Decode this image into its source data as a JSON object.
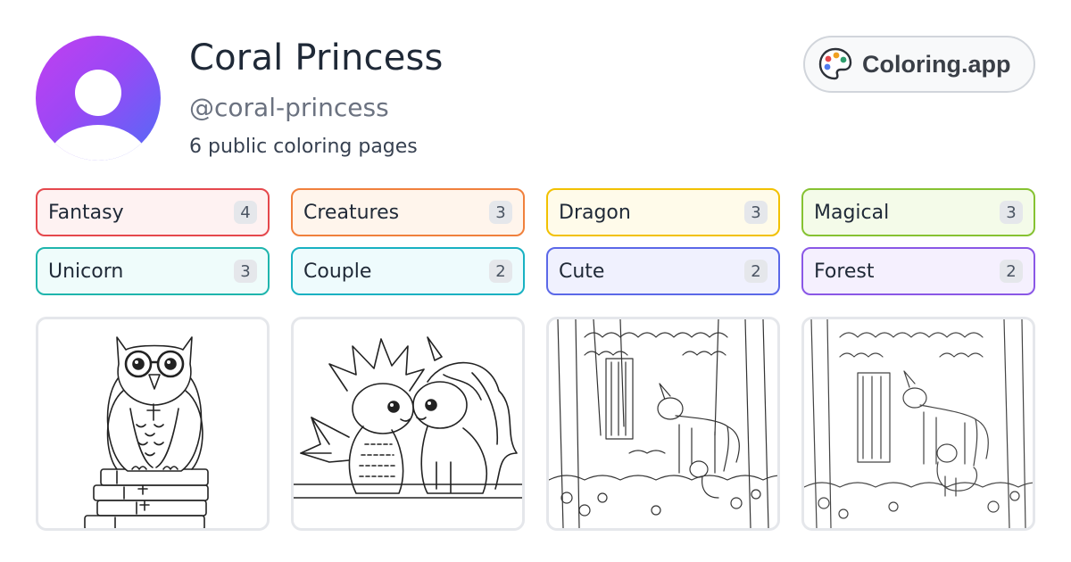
{
  "profile": {
    "name": "Coral Princess",
    "handle": "@coral-princess",
    "page_count_text": "6 public coloring pages",
    "avatar_gradient": [
      "#c23ff0",
      "#4f6cf7"
    ]
  },
  "brand": {
    "label": "Coloring.app",
    "icon": "palette-icon"
  },
  "tags": [
    {
      "label": "Fantasy",
      "count": "4",
      "border": "#e5484d",
      "bg": "#fef2f2"
    },
    {
      "label": "Creatures",
      "count": "3",
      "border": "#f0803c",
      "bg": "#fff5ec"
    },
    {
      "label": "Dragon",
      "count": "3",
      "border": "#f2c100",
      "bg": "#fffbea"
    },
    {
      "label": "Magical",
      "count": "3",
      "border": "#86c232",
      "bg": "#f4fbe9"
    },
    {
      "label": "Unicorn",
      "count": "3",
      "border": "#1fb5ad",
      "bg": "#effcfb"
    },
    {
      "label": "Couple",
      "count": "2",
      "border": "#18b1c2",
      "bg": "#eefbfd"
    },
    {
      "label": "Cute",
      "count": "2",
      "border": "#5b68e8",
      "bg": "#f0f1fe"
    },
    {
      "label": "Forest",
      "count": "2",
      "border": "#8a57e6",
      "bg": "#f5f0fe"
    }
  ],
  "thumbnails": [
    {
      "subject": "owl-on-books-image"
    },
    {
      "subject": "dragon-and-unicorn-image"
    },
    {
      "subject": "unicorns-in-forest-image"
    },
    {
      "subject": "unicorn-family-forest-image"
    }
  ]
}
